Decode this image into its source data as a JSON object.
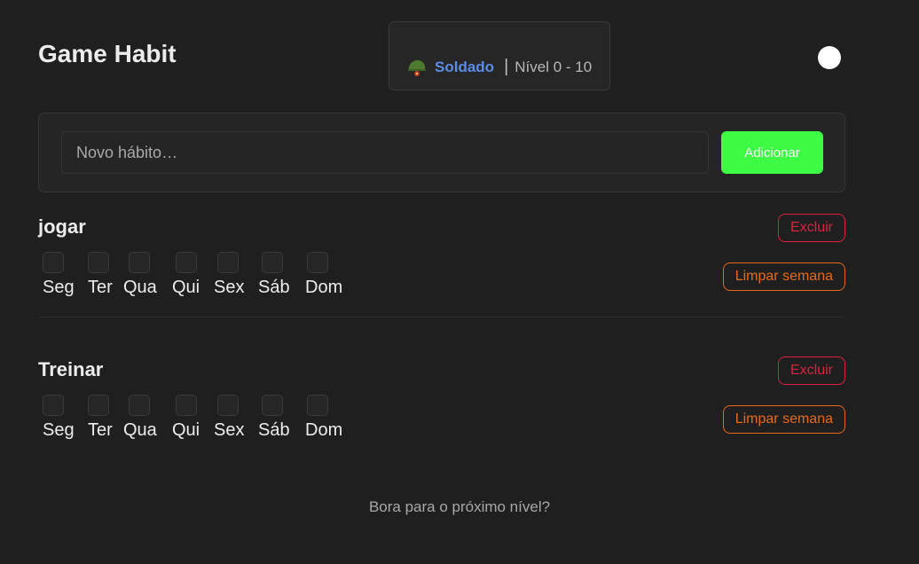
{
  "header": {
    "title": "Game Habit",
    "rank": {
      "icon": "soldier-helmet-icon",
      "name": "Soldado",
      "separator": "|",
      "level": "Nível 0 - 10"
    },
    "theme_toggle_icon": "theme-toggle-circle"
  },
  "add_habit": {
    "placeholder": "Novo hábito…",
    "value": "",
    "button_label": "Adicionar"
  },
  "habits": [
    {
      "name": "jogar",
      "days": [
        "Seg",
        "Ter",
        "Qua",
        "Qui",
        "Sex",
        "Sáb",
        "Dom"
      ],
      "checked": [
        false,
        false,
        false,
        false,
        false,
        false,
        false
      ],
      "delete_label": "Excluir",
      "clear_label": "Limpar semana"
    },
    {
      "name": "Treinar",
      "days": [
        "Seg",
        "Ter",
        "Qua",
        "Qui",
        "Sex",
        "Sáb",
        "Dom"
      ],
      "checked": [
        false,
        false,
        false,
        false,
        false,
        false,
        false
      ],
      "delete_label": "Excluir",
      "clear_label": "Limpar semana"
    }
  ],
  "footer": {
    "text": "Bora para o próximo nível?"
  },
  "colors": {
    "background": "#1f1f1f",
    "rank_accent": "#5b8ce6",
    "add_button": "#3dfc43",
    "delete": "#e0203f",
    "clear": "#e76a1a"
  }
}
